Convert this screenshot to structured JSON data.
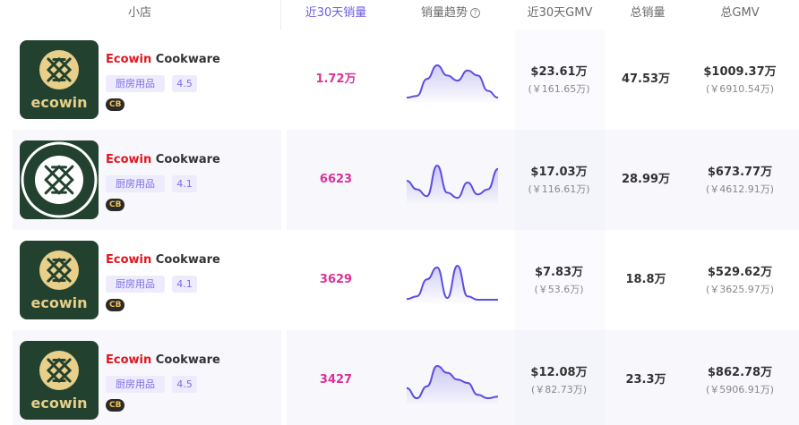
{
  "columns": {
    "shop": "小店",
    "sales_30d": "近30天销量",
    "trend": "销量趋势",
    "gmv_30d": "近30天GMV",
    "total_sales": "总销量",
    "total_gmv": "总GMV"
  },
  "colors": {
    "accent": "#6a5be8",
    "sales_pink": "#d6339a",
    "brand_red": "#e3141c",
    "logo_green": "#22422f",
    "logo_gold": "#e8cf8a"
  },
  "rows": [
    {
      "logo_text": "ecowin",
      "brand": "Ecowin",
      "name_suffix": " Cookware",
      "category": "厨房用品",
      "rating": "4.5",
      "badge": "CB",
      "sales_30d": "1.72万",
      "gmv_30d": "$23.61万",
      "gmv_30d_cny": "(￥161.65万)",
      "total_sales": "47.53万",
      "total_gmv": "$1009.37万",
      "total_gmv_cny": "(￥6910.54万)",
      "trend": [
        0.05,
        0.1,
        0.6,
        1.0,
        0.7,
        0.55,
        0.85,
        0.7,
        0.25,
        0.05
      ]
    },
    {
      "logo_text": "",
      "brand": "Ecowin",
      "name_suffix": " Cookware",
      "category": "厨房用品",
      "rating": "4.1",
      "badge": "CB",
      "sales_30d": "6623",
      "gmv_30d": "$17.03万",
      "gmv_30d_cny": "(￥116.61万)",
      "total_sales": "28.99万",
      "total_gmv": "$673.77万",
      "total_gmv_cny": "(￥4612.91万)",
      "trend": [
        0.55,
        0.3,
        0.1,
        1.0,
        0.2,
        0.05,
        0.5,
        0.15,
        0.3,
        0.9
      ]
    },
    {
      "logo_text": "ecowin",
      "brand": "Ecowin",
      "name_suffix": " Cookware",
      "category": "厨房用品",
      "rating": "4.1",
      "badge": "CB",
      "sales_30d": "3629",
      "gmv_30d": "$7.83万",
      "gmv_30d_cny": "(￥53.6万)",
      "total_sales": "18.8万",
      "total_gmv": "$529.62万",
      "total_gmv_cny": "(￥3625.97万)",
      "trend": [
        0.02,
        0.1,
        0.6,
        0.95,
        0.05,
        1.0,
        0.1,
        0.0,
        0.0,
        0.0
      ]
    },
    {
      "logo_text": "ecowin",
      "brand": "Ecowin",
      "name_suffix": " Cookware",
      "category": "厨房用品",
      "rating": "4.5",
      "badge": "CB",
      "sales_30d": "3427",
      "gmv_30d": "$12.08万",
      "gmv_30d_cny": "(￥82.73万)",
      "total_sales": "23.3万",
      "total_gmv": "$862.78万",
      "total_gmv_cny": "(￥5906.91万)",
      "trend": [
        0.35,
        0.05,
        0.4,
        1.0,
        0.8,
        0.6,
        0.5,
        0.15,
        0.05,
        0.1
      ]
    }
  ]
}
